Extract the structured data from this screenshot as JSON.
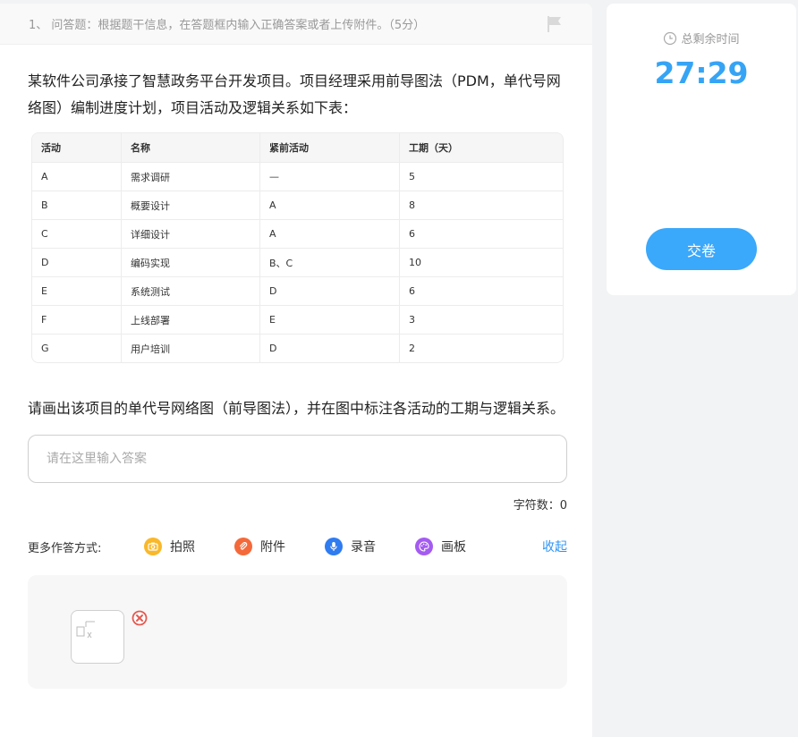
{
  "question": {
    "header": "1、 问答题：根据题干信息，在答题框内输入正确答案或者上传附件。（5分）",
    "stem": "某软件公司承接了智慧政务平台开发项目。项目经理采用前导图法（PDM，单代号网络图）编制进度计划，项目活动及逻辑关系如下表：",
    "table": {
      "headers": [
        "活动",
        "名称",
        "紧前活动",
        "工期（天）"
      ],
      "rows": [
        [
          "A",
          "需求调研",
          "—",
          "5"
        ],
        [
          "B",
          "概要设计",
          "A",
          "8"
        ],
        [
          "C",
          "详细设计",
          "A",
          "6"
        ],
        [
          "D",
          "编码实现",
          "B、C",
          "10"
        ],
        [
          "E",
          "系统测试",
          "D",
          "6"
        ],
        [
          "F",
          "上线部署",
          "E",
          "3"
        ],
        [
          "G",
          "用户培训",
          "D",
          "2"
        ]
      ]
    },
    "prompt": "请画出该项目的单代号网络图（前导图法），并在图中标注各活动的工期与逻辑关系。"
  },
  "answer": {
    "placeholder": "请在这里输入答案",
    "value": "",
    "char_count_label": "字符数：",
    "char_count": "0"
  },
  "more_methods": {
    "label": "更多作答方式:",
    "items": [
      {
        "label": "拍照",
        "icon": "camera-icon",
        "color": "#f9b82a"
      },
      {
        "label": "附件",
        "icon": "paperclip-icon",
        "color": "#f4693a"
      },
      {
        "label": "录音",
        "icon": "microphone-icon",
        "color": "#2f7bf0"
      },
      {
        "label": "画板",
        "icon": "palette-icon",
        "color": "#a45bf0"
      }
    ],
    "collapse_label": "收起"
  },
  "timer": {
    "label": "总剩余时间",
    "value": "27:29",
    "accent": "#36a4f5"
  },
  "submit": {
    "label": "交卷",
    "color": "#3aa8fb"
  }
}
